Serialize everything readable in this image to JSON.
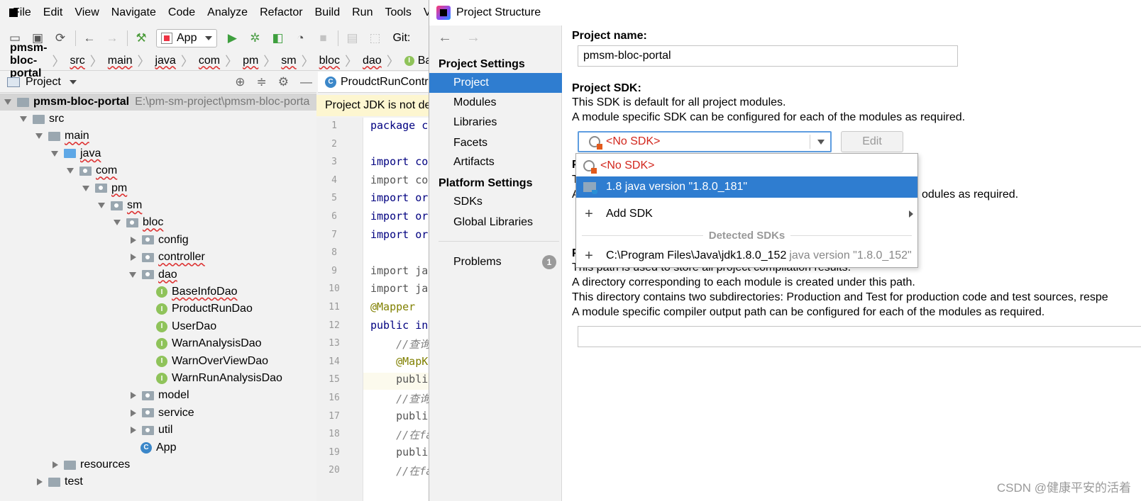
{
  "ide": {
    "menu": [
      "File",
      "Edit",
      "View",
      "Navigate",
      "Code",
      "Analyze",
      "Refactor",
      "Build",
      "Run",
      "Tools",
      "V"
    ],
    "run_config": "App",
    "git_label": "Git:",
    "breadcrumb": [
      "pmsm-bloc-portal",
      "src",
      "main",
      "java",
      "com",
      "pm",
      "sm",
      "bloc",
      "dao",
      "BaseIn"
    ],
    "project_panel": {
      "title": "Project",
      "root": {
        "name": "pmsm-bloc-portal",
        "path": "E:\\pm-sm-project\\pmsm-bloc-porta"
      },
      "tree": [
        {
          "label": "src",
          "depth": 1,
          "kind": "folder",
          "open": true
        },
        {
          "label": "main",
          "depth": 2,
          "kind": "folder",
          "open": true
        },
        {
          "label": "java",
          "depth": 3,
          "kind": "folder-blue",
          "open": true
        },
        {
          "label": "com",
          "depth": 4,
          "kind": "pkg",
          "open": true
        },
        {
          "label": "pm",
          "depth": 5,
          "kind": "pkg",
          "open": true
        },
        {
          "label": "sm",
          "depth": 6,
          "kind": "pkg",
          "open": true
        },
        {
          "label": "bloc",
          "depth": 7,
          "kind": "pkg",
          "open": true
        },
        {
          "label": "config",
          "depth": 8,
          "kind": "pkg",
          "open": false
        },
        {
          "label": "controller",
          "depth": 8,
          "kind": "pkg",
          "open": false
        },
        {
          "label": "dao",
          "depth": 8,
          "kind": "pkg",
          "open": true
        },
        {
          "label": "BaseInfoDao",
          "depth": 9,
          "kind": "iface"
        },
        {
          "label": "ProductRunDao",
          "depth": 9,
          "kind": "iface"
        },
        {
          "label": "UserDao",
          "depth": 9,
          "kind": "iface"
        },
        {
          "label": "WarnAnalysisDao",
          "depth": 9,
          "kind": "iface"
        },
        {
          "label": "WarnOverViewDao",
          "depth": 9,
          "kind": "iface"
        },
        {
          "label": "WarnRunAnalysisDao",
          "depth": 9,
          "kind": "iface"
        },
        {
          "label": "model",
          "depth": 8,
          "kind": "pkg",
          "open": false
        },
        {
          "label": "service",
          "depth": 8,
          "kind": "pkg",
          "open": false
        },
        {
          "label": "util",
          "depth": 8,
          "kind": "pkg",
          "open": false
        },
        {
          "label": "App",
          "depth": 8,
          "kind": "class"
        },
        {
          "label": "resources",
          "depth": 3,
          "kind": "folder",
          "open": false
        },
        {
          "label": "test",
          "depth": 2,
          "kind": "folder",
          "open": false
        }
      ]
    },
    "editor": {
      "tab": "ProudctRunContr",
      "jdk_notice": "Project JDK is not de",
      "lines": [
        {
          "n": "1",
          "code": "package co",
          "style": "kw"
        },
        {
          "n": "2",
          "code": "",
          "style": ""
        },
        {
          "n": "3",
          "code": "import co",
          "style": "kw"
        },
        {
          "n": "4",
          "code": "import co",
          "style": "grey"
        },
        {
          "n": "5",
          "code": "import org",
          "style": "kw"
        },
        {
          "n": "6",
          "code": "import org",
          "style": "kw"
        },
        {
          "n": "7",
          "code": "import org",
          "style": "kw"
        },
        {
          "n": "8",
          "code": "",
          "style": ""
        },
        {
          "n": "9",
          "code": "import jav",
          "style": "grey"
        },
        {
          "n": "10",
          "code": "import jav",
          "style": "grey"
        },
        {
          "n": "11",
          "code": "@Mapper",
          "style": "ann"
        },
        {
          "n": "12",
          "code": "public int",
          "style": "kw"
        },
        {
          "n": "13",
          "code": "    //查询",
          "style": "cmt"
        },
        {
          "n": "14",
          "code": "    @MapKe",
          "style": "ann"
        },
        {
          "n": "15",
          "code": "    public",
          "style": "grey"
        },
        {
          "n": "16",
          "code": "    //查询",
          "style": "cmt"
        },
        {
          "n": "17",
          "code": "    public",
          "style": "grey"
        },
        {
          "n": "18",
          "code": "    //在fa",
          "style": "cmt"
        },
        {
          "n": "19",
          "code": "    public",
          "style": "grey"
        },
        {
          "n": "20",
          "code": "    //在fa",
          "style": "cmt"
        }
      ]
    }
  },
  "dialog": {
    "title": "Project Structure",
    "nav": {
      "project_settings_header": "Project Settings",
      "project_settings": [
        "Project",
        "Modules",
        "Libraries",
        "Facets",
        "Artifacts"
      ],
      "platform_settings_header": "Platform Settings",
      "platform_settings": [
        "SDKs",
        "Global Libraries"
      ],
      "problems": "Problems",
      "problems_count": "1"
    },
    "project_name_label": "Project name:",
    "project_name_value": "pmsm-bloc-portal",
    "project_sdk_label": "Project SDK:",
    "sdk_desc_1": "This SDK is default for all project modules.",
    "sdk_desc_2": "A module specific SDK can be configured for each of the modules as required.",
    "sdk_selected": "<No SDK>",
    "edit_button": "Edit",
    "hidden_label_initial_1": "P",
    "hidden_line_initial_1": "T",
    "hidden_line_initial_2": "A",
    "hidden_line_tail": "odules as required.",
    "hidden_label_initial_2": "P",
    "output_desc_1": "This path is used to store all project compilation results.",
    "output_desc_2": "A directory corresponding to each module is created under this path.",
    "output_desc_3": "This directory contains two subdirectories: Production and Test for production code and test sources, respe",
    "output_desc_4": "A module specific compiler output path can be configured for each of the modules as required.",
    "sdk_popup": {
      "no_sdk": "<No SDK>",
      "java_18": "1.8 java version \"1.8.0_181\"",
      "add_sdk": "Add SDK",
      "detected_header": "Detected SDKs",
      "detected_path": "C:\\Program Files\\Java\\jdk1.8.0_152",
      "detected_version": "java version \"1.8.0_152\""
    }
  },
  "watermark": "CSDN @健康平安的活着"
}
